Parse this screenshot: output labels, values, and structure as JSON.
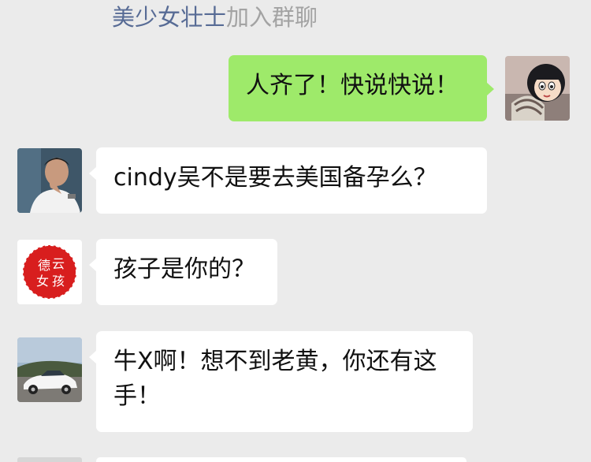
{
  "system_message": {
    "name": "美少女壮士",
    "text": "加入群聊"
  },
  "messages": [
    {
      "side": "right",
      "text": "人齐了！快说快说！",
      "avatar_icon": "cartoon-girl-avatar-icon"
    },
    {
      "side": "left",
      "text": "cindy吴不是要去美国备孕么？",
      "avatar_icon": "man-portrait-avatar-icon"
    },
    {
      "side": "left",
      "text": "孩子是你的？",
      "avatar_icon": "deyun-nvhai-seal-avatar-icon"
    },
    {
      "side": "left",
      "text": "牛X啊！想不到老黄，你还有这手！",
      "avatar_icon": "white-sports-car-avatar-icon"
    }
  ],
  "avatar_seal_text": "德云女孩",
  "colors": {
    "background": "#ebebeb",
    "sent_bubble": "#9eea6a",
    "received_bubble": "#ffffff",
    "system_name": "#576b95",
    "system_text": "#a3a3a3"
  }
}
